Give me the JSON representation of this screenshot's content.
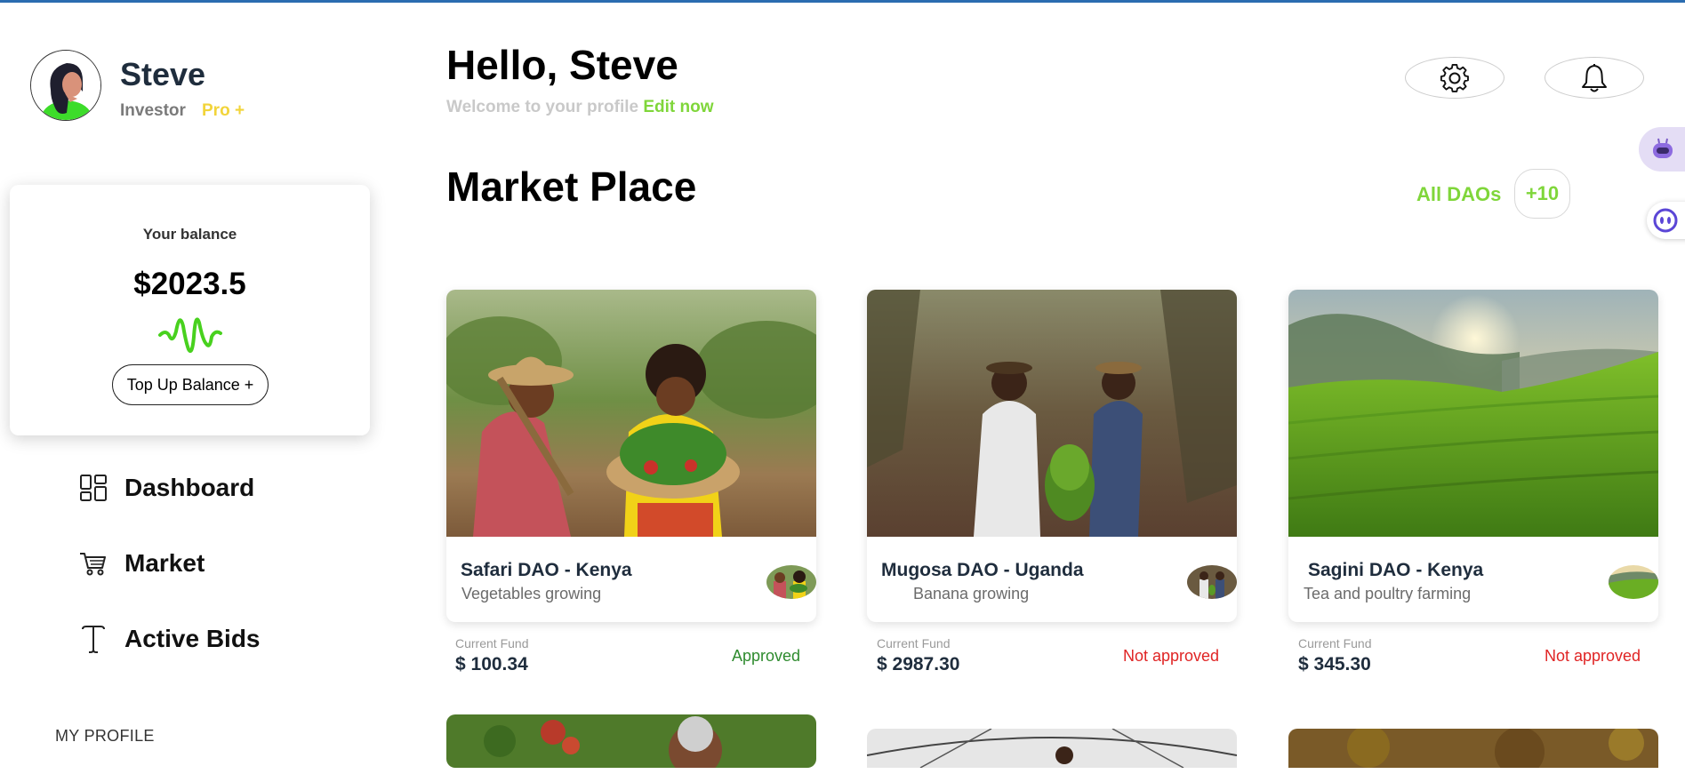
{
  "user": {
    "name": "Steve",
    "role": "Investor",
    "tier": "Pro +"
  },
  "balance": {
    "label": "Your balance",
    "value": "$2023.5",
    "topup_label": "Top Up Balance +"
  },
  "nav": {
    "items": [
      {
        "label": "Dashboard",
        "icon": "dashboard-icon"
      },
      {
        "label": "Market",
        "icon": "cart-icon"
      },
      {
        "label": "Active Bids",
        "icon": "bids-icon"
      }
    ],
    "profile_heading": "MY PROFILE"
  },
  "header": {
    "greeting": "Hello, Steve",
    "welcome_text": "Welcome to your profile",
    "edit_link": "Edit now",
    "settings_icon": "gear-icon",
    "notifications_icon": "bell-icon"
  },
  "market": {
    "title": "Market Place",
    "all_link": "All DAOs",
    "extra_count": "+10",
    "fund_label": "Current Fund",
    "cards": [
      {
        "name": "Safari DAO - Kenya",
        "description": "Vegetables growing",
        "fund": "$ 100.34",
        "status": "Approved",
        "approved": true
      },
      {
        "name": "Mugosa DAO - Uganda",
        "description": "Banana growing",
        "fund": "$ 2987.30",
        "status": "Not approved",
        "approved": false
      },
      {
        "name": "Sagini DAO - Kenya",
        "description": "Tea and poultry farming",
        "fund": "$ 345.30",
        "status": "Not approved",
        "approved": false
      }
    ]
  },
  "colors": {
    "accent_green": "#7fd63a",
    "tier_yellow": "#f2d43a",
    "approved_green": "#2e8b2e",
    "rejected_red": "#e02424",
    "top_bar_blue": "#2b6cb0"
  }
}
